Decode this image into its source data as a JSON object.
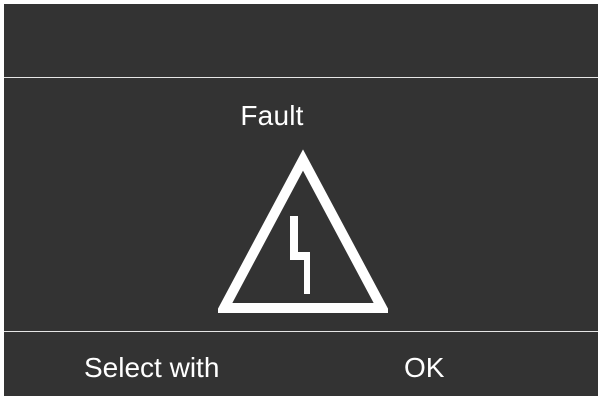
{
  "screen": {
    "title": "Fault",
    "icon": "high-voltage-warning-icon",
    "colors": {
      "background": "#333333",
      "foreground": "#ffffff",
      "divider": "#e6e6e6"
    }
  },
  "footer": {
    "left_label": "Select with",
    "right_label": "OK"
  }
}
